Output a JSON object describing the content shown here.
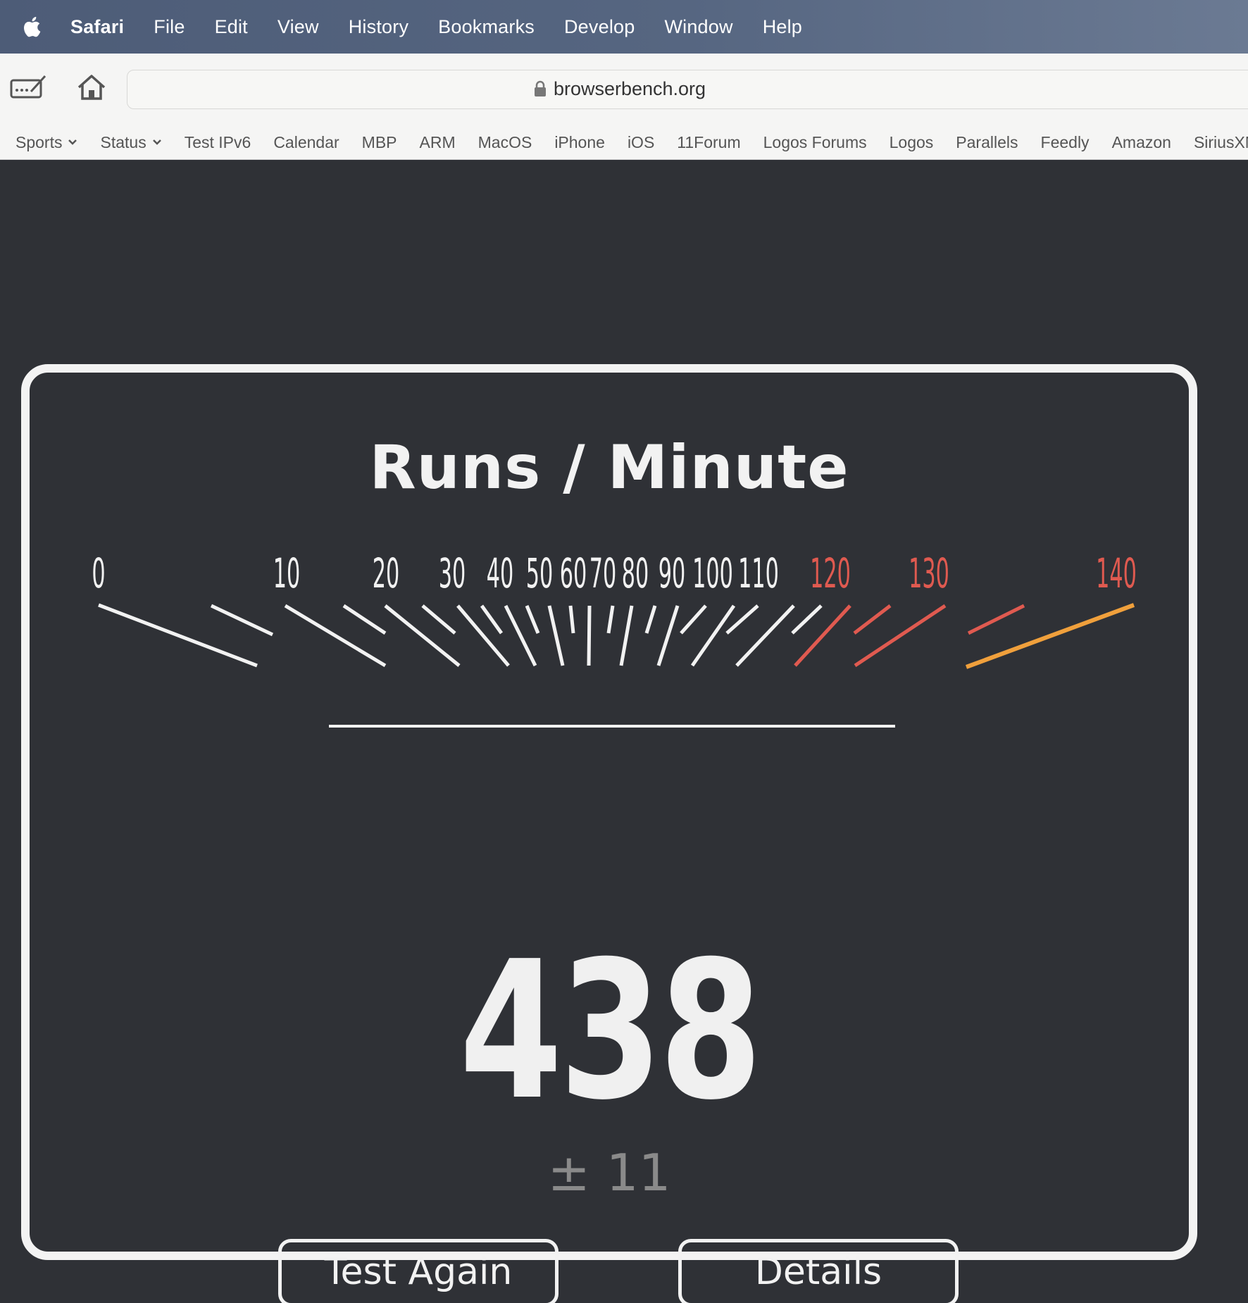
{
  "menubar": {
    "apple_icon": "apple-logo-icon",
    "items": [
      "Safari",
      "File",
      "Edit",
      "View",
      "History",
      "Bookmarks",
      "Develop",
      "Window",
      "Help"
    ]
  },
  "toolbar": {
    "icons": [
      "sidebar-edit-icon",
      "home-icon"
    ],
    "url": "browserbench.org"
  },
  "bookmarks": [
    {
      "label": "Sports",
      "dropdown": true
    },
    {
      "label": "Status",
      "dropdown": true
    },
    {
      "label": "Test IPv6"
    },
    {
      "label": "Calendar"
    },
    {
      "label": "MBP"
    },
    {
      "label": "ARM"
    },
    {
      "label": "MacOS"
    },
    {
      "label": "iPhone"
    },
    {
      "label": "iOS"
    },
    {
      "label": "11Forum"
    },
    {
      "label": "Logos Forums"
    },
    {
      "label": "Logos"
    },
    {
      "label": "Parallels"
    },
    {
      "label": "Feedly"
    },
    {
      "label": "Amazon"
    },
    {
      "label": "SiriusXM"
    }
  ],
  "page": {
    "title": "Runs / Minute",
    "score": "438",
    "error": "± 11",
    "buttons": {
      "test_again": "Test Again",
      "details": "Details"
    }
  },
  "gauge": {
    "labels": [
      "0",
      "10",
      "20",
      "30",
      "40",
      "50",
      "60",
      "70",
      "80",
      "90",
      "100",
      "110",
      "120",
      "130",
      "140"
    ],
    "colors": {
      "normal": "#f2f2f2",
      "warning": "#e05a50",
      "needle": "#f0a03c"
    }
  }
}
